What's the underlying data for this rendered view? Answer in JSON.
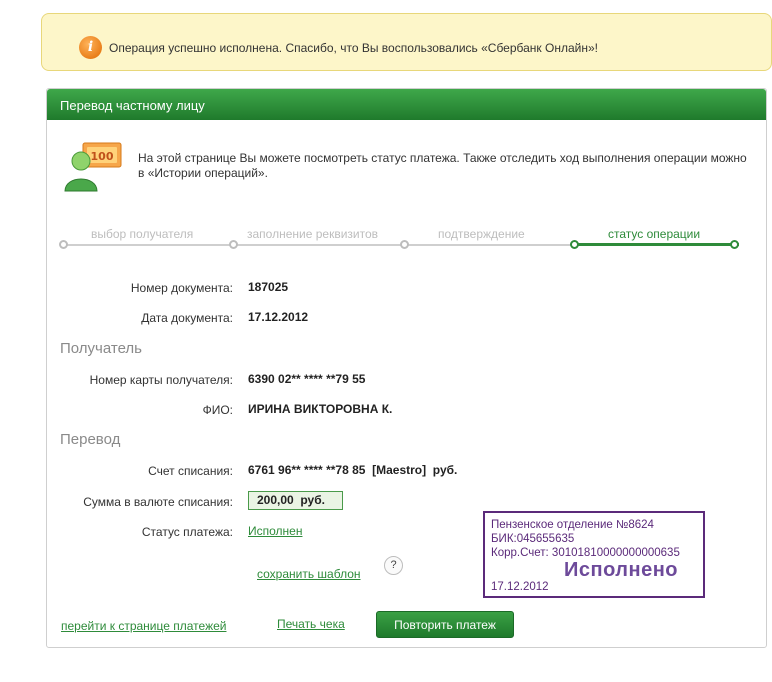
{
  "notice": {
    "text": "Операция успешно исполнена. Спасибо, что Вы воспользовались «Сбербанк Онлайн»!"
  },
  "panel": {
    "title": "Перевод частному лицу",
    "intro": "На этой странице Вы можете посмотреть статус платежа. Также отследить ход выполнения операции можно в «Истории операций».",
    "intro_image_text": "100"
  },
  "steps": [
    {
      "label": "выбор получателя",
      "active": false
    },
    {
      "label": "заполнение реквизитов",
      "active": false
    },
    {
      "label": "подтверждение",
      "active": false
    },
    {
      "label": "статус операции",
      "active": true
    }
  ],
  "document": {
    "number_label": "Номер документа:",
    "number": "187025",
    "date_label": "Дата документа:",
    "date": "17.12.2012"
  },
  "recipient": {
    "section_title": "Получатель",
    "card_label": "Номер карты получателя:",
    "card": "6390 02** **** **79 55",
    "name_label": "ФИО:",
    "name": "ИРИНА ВИКТОРОВНА К."
  },
  "transfer": {
    "section_title": "Перевод",
    "account_label": "Счет списания:",
    "account": "6761 96** **** **78 85  [Maestro]  руб.",
    "amount_label": "Сумма в валюте списания:",
    "amount": "200,00  руб.",
    "status_label": "Статус платежа:",
    "status": "Исполнен",
    "save_template": "сохранить шаблон",
    "help_symbol": "?"
  },
  "stamp": {
    "line1": "Пензенское отделение №8624",
    "line2": "БИК:045655635",
    "line3": "Корр.Счет: 30101810000000000635",
    "status_word": "Исполнено",
    "date": "17.12.2012"
  },
  "actions": {
    "payments_link": "перейти к странице платежей",
    "print_link": "Печать чека",
    "repeat_button": "Повторить платеж"
  },
  "colors": {
    "brand_green": "#2e8b3a",
    "notice_bg": "#fdf6c9",
    "stamp_purple": "#5b2a7a"
  }
}
